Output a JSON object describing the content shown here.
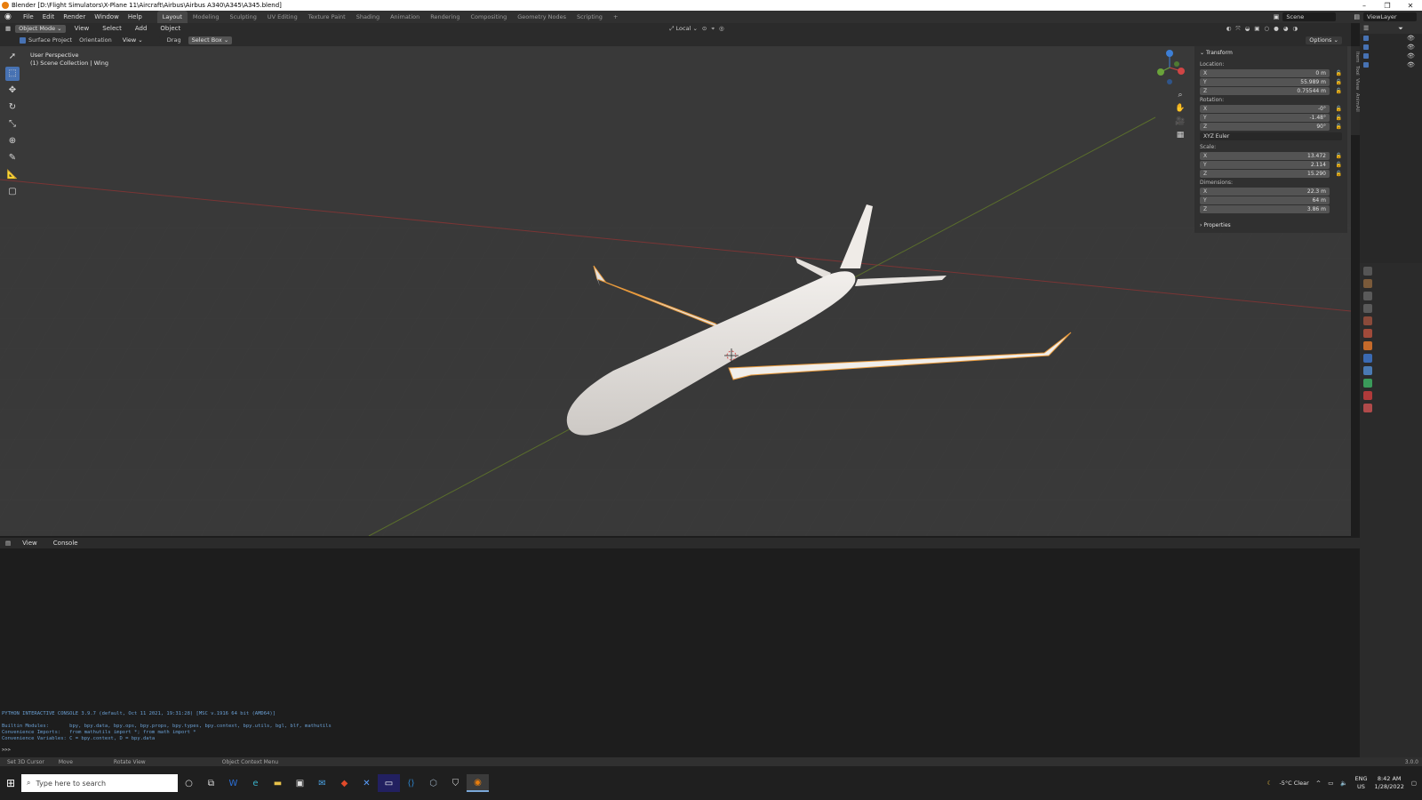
{
  "window": {
    "title": "Blender [D:\\Flight Simulators\\X-Plane 11\\Aircraft\\Airbus\\Airbus A340\\A345\\A345.blend]"
  },
  "menu": {
    "items": [
      "File",
      "Edit",
      "Render",
      "Window",
      "Help"
    ]
  },
  "workspaces": {
    "tabs": [
      "Layout",
      "Modeling",
      "Sculpting",
      "UV Editing",
      "Texture Paint",
      "Shading",
      "Animation",
      "Rendering",
      "Compositing",
      "Geometry Nodes",
      "Scripting"
    ],
    "add": "+"
  },
  "topright": {
    "scene": "Scene",
    "viewlayer": "ViewLayer"
  },
  "header": {
    "mode": "Object Mode",
    "menus": [
      "View",
      "Select",
      "Add",
      "Object"
    ],
    "transform_orientation": "Local",
    "options": "Options"
  },
  "tool_settings": {
    "surface_project": "Surface Project",
    "orientation_label": "Orientation",
    "orientation_value": "View",
    "drag_label": "Drag",
    "drag_value": "Select Box"
  },
  "viewport": {
    "perspective": "User Perspective",
    "collection": "(1) Scene Collection | Wing"
  },
  "npanel": {
    "section": "Transform",
    "location_label": "Location:",
    "location": {
      "x": "0 m",
      "y": "55.989 m",
      "z": "0.75544 m"
    },
    "rotation_label": "Rotation:",
    "rotation": {
      "x": "-0°",
      "y": "-1.48°",
      "z": "90°"
    },
    "rotation_mode": "XYZ Euler",
    "scale_label": "Scale:",
    "scale": {
      "x": "13.472",
      "y": "2.114",
      "z": "15.290"
    },
    "dimensions_label": "Dimensions:",
    "dimensions": {
      "x": "22.3 m",
      "y": "64 m",
      "z": "3.86 m"
    },
    "properties": "Properties",
    "tabs": [
      "Item",
      "Tool",
      "View",
      "AnimAll"
    ]
  },
  "console": {
    "menus": [
      "View",
      "Console"
    ],
    "lines": [
      "PYTHON INTERACTIVE CONSOLE 3.9.7 (default, Oct 11 2021, 19:31:28) [MSC v.1916 64 bit (AMD64)]",
      "Builtin Modules:       bpy, bpy.data, bpy.ops, bpy.props, bpy.types, bpy.context, bpy.utils, bgl, blf, mathutils",
      "Convenience Imports:   from mathutils import *; from math import *",
      "Convenience Variables: C = bpy.context, D = bpy.data",
      ">>> "
    ]
  },
  "statusbar": {
    "items": [
      "Set 3D Cursor",
      "Move",
      "Rotate View",
      "Object Context Menu"
    ],
    "version": "3.0.0"
  },
  "taskbar": {
    "search_placeholder": "Type here to search",
    "weather": "-5°C  Clear",
    "lang": "ENG",
    "region": "US",
    "time": "8:42 AM",
    "date": "1/28/2022"
  },
  "colors": {
    "accent": "#4772b3",
    "selection_outline": "#e89a3c",
    "axis_x": "#8a3a3a",
    "axis_y": "#5a7a2a",
    "viewport_bg": "#393939"
  }
}
